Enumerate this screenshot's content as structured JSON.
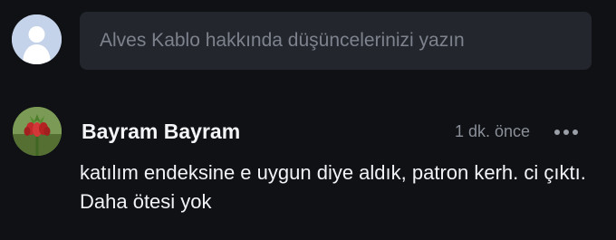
{
  "composer": {
    "placeholder": "Alves Kablo hakkında düşüncelerinizi yazın",
    "avatar_icon": "default-user-avatar"
  },
  "comment": {
    "author": "Bayram Bayram",
    "timestamp": "1 dk. önce",
    "body": "katılım endeksine e uygun diye aldık, patron kerh. ci çıktı. Daha ötesi yok",
    "avatar_icon": "flower-avatar",
    "more_icon": "ellipsis-icon"
  },
  "colors": {
    "background": "#0f1115",
    "input_background": "#23262d",
    "placeholder": "#7d828c",
    "muted_text": "#8a8f98",
    "primary_text": "#f2f3f5"
  }
}
